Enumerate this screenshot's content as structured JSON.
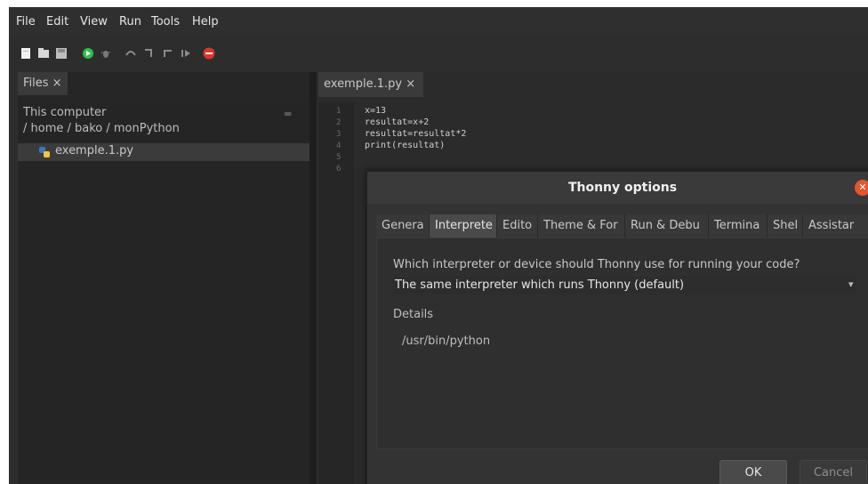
{
  "menubar": {
    "items": [
      "File",
      "Edit",
      "View",
      "Run",
      "Tools",
      "Help"
    ]
  },
  "toolbar": {
    "icons": [
      "new-file-icon",
      "open-file-icon",
      "save-file-icon",
      "run-icon",
      "debug-icon",
      "step-over-icon",
      "step-into-icon",
      "step-out-icon",
      "resume-icon",
      "stop-icon"
    ],
    "colors": {
      "run": "#2fbf4f",
      "stop": "#d9372d"
    }
  },
  "files": {
    "tab_label": "Files ×",
    "location_title": "This computer",
    "location_path": "/ home / bako / monPython",
    "file_name": "exemple.1.py"
  },
  "editor": {
    "tab_label": "exemple.1.py ×",
    "line_numbers": [
      "1",
      "2",
      "3",
      "4",
      "5",
      "6"
    ],
    "code_lines": [
      "x=13",
      "resultat=x+2",
      "resultat=resultat*2",
      "print(resultat)",
      "",
      ""
    ]
  },
  "dialog": {
    "title": "Thonny options",
    "tabs": [
      "Genera",
      "Interprete",
      "Edito",
      "Theme & For",
      "Run & Debu",
      "Termina",
      "Shel",
      "Assistar"
    ],
    "active_tab": "Interprete",
    "question": "Which interpreter or device should Thonny use for running your code?",
    "selected_interpreter": "The same interpreter which runs Thonny (default)",
    "details_label": "Details",
    "interpreter_path": "/usr/bin/python",
    "ok_label": "OK",
    "cancel_label": "Cancel"
  }
}
